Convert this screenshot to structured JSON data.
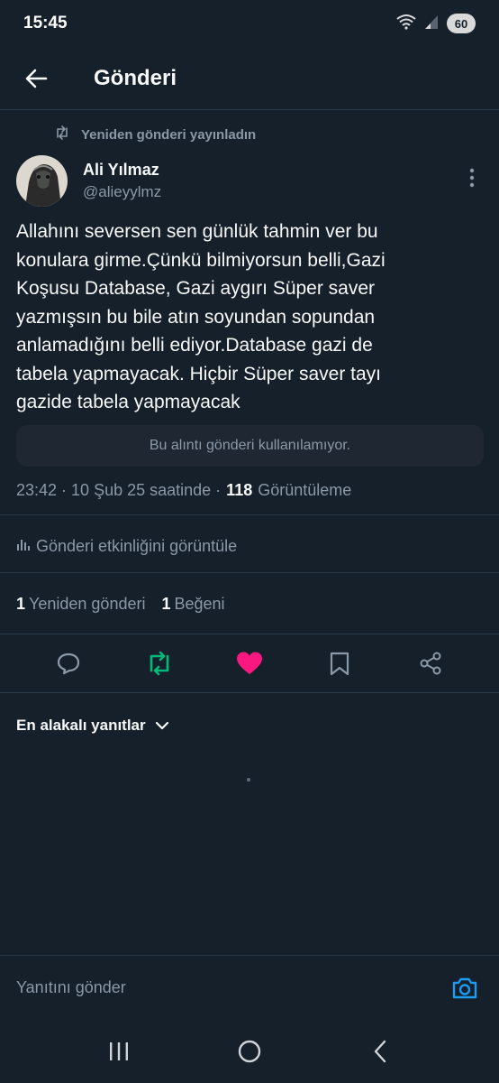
{
  "status_bar": {
    "time": "15:45",
    "battery": "60",
    "icons": [
      "wifi-icon",
      "signal-icon",
      "battery-icon"
    ]
  },
  "header": {
    "title": "Gönderi",
    "back_icon": "back-arrow-icon"
  },
  "repost_label": "Yeniden gönderi yayınladın",
  "author": {
    "name": "Ali Yılmaz",
    "handle": "@alieyylmz"
  },
  "post": {
    "lines": [
      "Allahını seversen sen günlük tahmin ver bu",
      "konulara girme.Çünkü bilmiyorsun belli,Gazi",
      "Koşusu Database, Gazi aygırı Süper saver",
      "yazmışsın bu bile atın soyundan sopundan",
      "anlamadığını belli ediyor.Database gazi de",
      "tabela yapmayacak. Hiçbir Süper saver  tayı",
      "gazide tabela yapmayacak"
    ],
    "quote_unavailable": "Bu alıntı gönderi kullanılamıyor.",
    "timestamp": "23:42 · 10 Şub 25 saatinde ·",
    "views_count": "118",
    "views_label": "Görüntüleme"
  },
  "activity_label": "Gönderi etkinliğini görüntüle",
  "counts": {
    "reposts_count": "1",
    "reposts_label": "Yeniden gönderi",
    "likes_count": "1",
    "likes_label": "Beğeni"
  },
  "actions": [
    "reply-icon",
    "repost-icon",
    "like-icon",
    "bookmark-icon",
    "share-icon"
  ],
  "colors": {
    "background": "#15202b",
    "repost_active": "#00ba7c",
    "like_active": "#f91880",
    "accent": "#1d9bf0",
    "muted": "#8b98a5"
  },
  "replies": {
    "sort_label": "En alakalı yanıtlar"
  },
  "reply_bar": {
    "placeholder": "Yanıtını gönder"
  }
}
